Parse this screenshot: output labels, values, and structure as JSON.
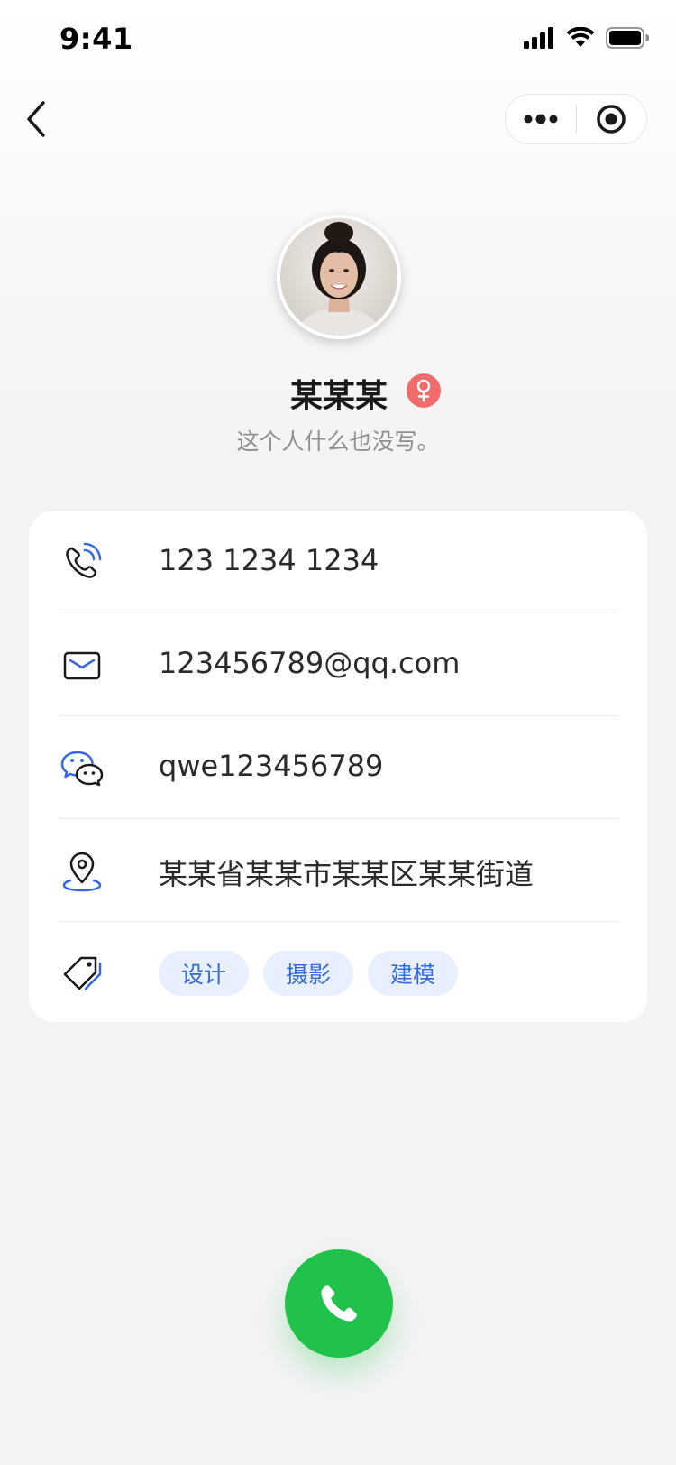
{
  "status_bar": {
    "time": "9:41"
  },
  "profile": {
    "name": "某某某",
    "gender_symbol": "♀",
    "bio": "这个人什么也没写。"
  },
  "contact": {
    "phone": "123 1234 1234",
    "email": "123456789@qq.com",
    "wechat": "qwe123456789",
    "address": "某某省某某市某某区某某街道",
    "tags": [
      "设计",
      "摄影",
      "建模"
    ]
  },
  "colors": {
    "accent_blue": "#3568e0",
    "tag_bg": "#e8f0ff",
    "call_green": "#21c24b",
    "female_badge": "#f26b6b"
  },
  "icons": {
    "back": "chevron-left-icon",
    "more": "more-dots-icon",
    "close": "target-circle-icon",
    "phone": "phone-icon",
    "email": "mail-icon",
    "wechat": "wechat-icon",
    "address": "location-pin-icon",
    "tags": "tag-icon",
    "call": "call-icon"
  }
}
